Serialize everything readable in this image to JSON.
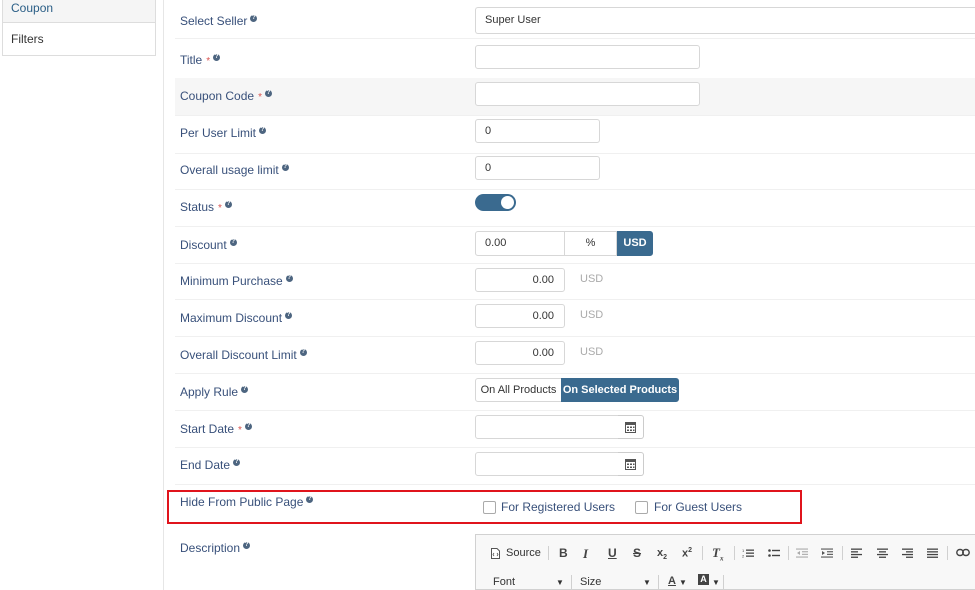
{
  "sidebar": {
    "items": [
      {
        "label": "Coupon"
      },
      {
        "label": "Filters"
      }
    ]
  },
  "help_glyph": "?",
  "required_mark": "*",
  "form": {
    "select_seller": {
      "label": "Select Seller",
      "value": "Super User"
    },
    "title": {
      "label": "Title",
      "value": ""
    },
    "coupon_code": {
      "label": "Coupon Code",
      "value": ""
    },
    "per_user_limit": {
      "label": "Per User Limit",
      "value": "0"
    },
    "overall_usage_limit": {
      "label": "Overall usage limit",
      "value": "0"
    },
    "status": {
      "label": "Status",
      "enabled": true
    },
    "discount": {
      "label": "Discount",
      "value": "0.00",
      "percent_label": "%",
      "usd_label": "USD",
      "selected": "USD"
    },
    "minimum_purchase": {
      "label": "Minimum Purchase",
      "value": "0.00",
      "unit": "USD"
    },
    "maximum_discount": {
      "label": "Maximum Discount",
      "value": "0.00",
      "unit": "USD"
    },
    "overall_discount_limit": {
      "label": "Overall Discount Limit",
      "value": "0.00",
      "unit": "USD"
    },
    "apply_rule": {
      "label": "Apply Rule",
      "option_all": "On All Products",
      "option_selected": "On Selected Products",
      "selected": "On Selected Products"
    },
    "start_date": {
      "label": "Start Date",
      "value": ""
    },
    "end_date": {
      "label": "End Date",
      "value": ""
    },
    "hide_from_public": {
      "label": "Hide From Public Page",
      "registered": {
        "label": "For Registered Users",
        "checked": false
      },
      "guest": {
        "label": "For Guest Users",
        "checked": false
      }
    },
    "description": {
      "label": "Description",
      "toolbar": {
        "source_label": "Source",
        "font_label": "Font",
        "size_label": "Size"
      }
    }
  },
  "colors": {
    "accent": "#3a6a8f",
    "label": "#38507a",
    "required": "#d9534f",
    "highlight_border": "#e0141c"
  }
}
